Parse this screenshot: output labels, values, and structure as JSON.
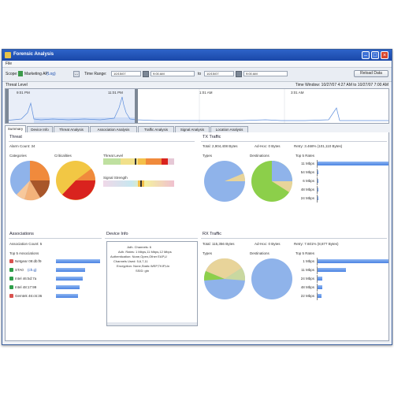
{
  "window": {
    "title": "Forensic Analysis"
  },
  "menu": {
    "file": "File"
  },
  "toolbar": {
    "scope_label": "Scope:",
    "scope_value": "Marketing AP",
    "scope_tag": "(Log)",
    "scope_btn": "...",
    "time_range_label": "Time Range:",
    "start_date": "10/15/07",
    "start_time": "9:00 AM",
    "to_label": "to",
    "end_date": "10/15/07",
    "end_time": "9:00 AM",
    "reload_label": "Reload Data"
  },
  "threat_level": {
    "label": "Threat Level",
    "time_window": "Time Window: 10/27/07 4:27 AM to 10/27/07 7:00 AM",
    "ticks": [
      "9:01 PM",
      "11:01 PM",
      "1:01 AM",
      "3:01 AM"
    ]
  },
  "tabs": [
    "Summary",
    "Device Info",
    "Threat Analysis",
    "Association Analysis",
    "Traffic Analysis",
    "Signal Analysis",
    "Location Analysis"
  ],
  "threat": {
    "title": "Threat",
    "alarm_count": "Alarm Count: 34",
    "categories_label": "Categories",
    "criticalities_label": "Criticalities",
    "threat_level_label": "Threat Level",
    "signal_strength_label": "Signal Strength"
  },
  "tx": {
    "title": "TX Traffic",
    "total": "Total: 2,904,408 Bytes",
    "adhoc": "Ad-Hoc: 0 Bytes",
    "retry": "Retry: 3.468% (101,110 Bytes)",
    "types_label": "Types",
    "dest_label": "Destinations",
    "rates_label": "Top 5 Rates",
    "rates": [
      {
        "label": "11 Mbps",
        "value": 100
      },
      {
        "label": "54 Mbps",
        "value": 1
      },
      {
        "label": "6 Mbps",
        "value": 1
      },
      {
        "label": "48 Mbps",
        "value": 1
      },
      {
        "label": "24 Mbps",
        "value": 1
      }
    ]
  },
  "associations": {
    "title": "Associations",
    "count": "Association Count: 5",
    "top_label": "Top 5 Associations",
    "items": [
      {
        "name": "Netgear 09:db:f9",
        "value": 100,
        "color": "#d9534f"
      },
      {
        "name": "STA0",
        "tag": "(ch.g)",
        "value": 66,
        "color": "#2e9e4a"
      },
      {
        "name": "Intel 46:5d:7a",
        "value": 60,
        "color": "#2e9e4a"
      },
      {
        "name": "Intel 48:17:99",
        "value": 53,
        "color": "#2e9e4a"
      },
      {
        "name": "Gemtek 46:c6:36",
        "value": 50,
        "color": "#d9534f"
      }
    ]
  },
  "device_info": {
    "title": "Device Info",
    "rows": [
      "Adh. Channels: 6",
      "Adh. Rates: 1 Mbps,11 Mbps,12 Mbps",
      "Authentication: None,Open,Other EAP,U",
      "Channels Used: 5,6,7,11",
      "Encryption: None,Static WEP,TKIP,Un",
      "SSID: gtn"
    ]
  },
  "rx": {
    "title": "RX Traffic",
    "total": "Total: 115,356 Bytes",
    "adhoc": "Ad-Hoc: 0 Bytes",
    "retry": "Retry: 7.601% (8,877 Bytes)",
    "types_label": "Types",
    "dest_label": "Destinations",
    "rates_label": "Top 5 Rates",
    "rates": [
      {
        "label": "1 Mbps",
        "value": 100
      },
      {
        "label": "11 Mbps",
        "value": 40
      },
      {
        "label": "24 Mbps",
        "value": 7
      },
      {
        "label": "48 Mbps",
        "value": 7
      },
      {
        "label": "22 Mbps",
        "value": 6
      }
    ]
  }
}
